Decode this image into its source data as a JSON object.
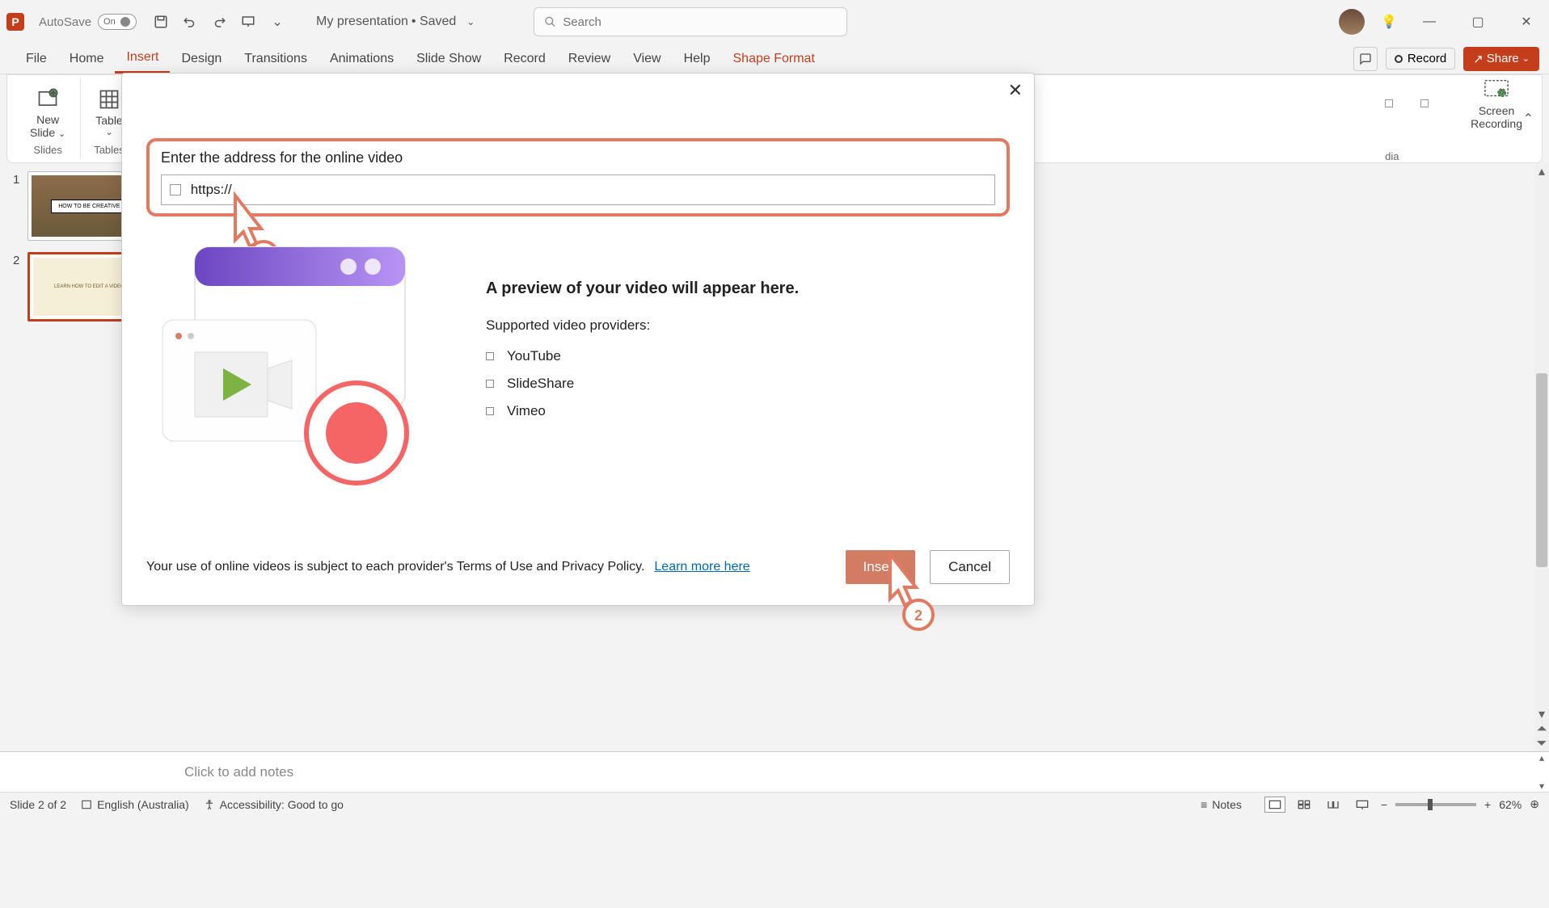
{
  "titlebar": {
    "autosave_label": "AutoSave",
    "autosave_state": "On",
    "doc_title": "My presentation",
    "saved_label": "• Saved",
    "search_placeholder": "Search"
  },
  "tabs": [
    "File",
    "Home",
    "Insert",
    "Design",
    "Transitions",
    "Animations",
    "Slide Show",
    "Record",
    "Review",
    "View",
    "Help",
    "Shape Format"
  ],
  "tab_right": {
    "record": "Record",
    "share": "Share"
  },
  "ribbon": {
    "new_slide": "New\nSlide",
    "table": "Table",
    "group_slides": "Slides",
    "group_tables": "Tables",
    "screen_recording": "Screen\nRecording",
    "media_label": "dia"
  },
  "slides": [
    {
      "num": "1",
      "title": "HOW TO BE CREATIVE"
    },
    {
      "num": "2",
      "title": "LEARN HOW TO EDIT A VIDEO"
    }
  ],
  "dialog": {
    "label": "Enter the address for the online video",
    "url_value": "https://",
    "preview_title": "A preview of your video will appear here.",
    "supported": "Supported video providers:",
    "providers": [
      "YouTube",
      "SlideShare",
      "Vimeo"
    ],
    "disclaimer": "Your use of online videos is subject to each provider's Terms of Use and Privacy Policy.",
    "learn_more": "Learn more here",
    "insert": "Insert",
    "cancel": "Cancel"
  },
  "callouts": {
    "one": "1",
    "two": "2"
  },
  "notes": {
    "placeholder": "Click to add notes"
  },
  "status": {
    "slide": "Slide 2 of 2",
    "language": "English (Australia)",
    "accessibility": "Accessibility: Good to go",
    "notes": "Notes",
    "zoom": "62%"
  }
}
